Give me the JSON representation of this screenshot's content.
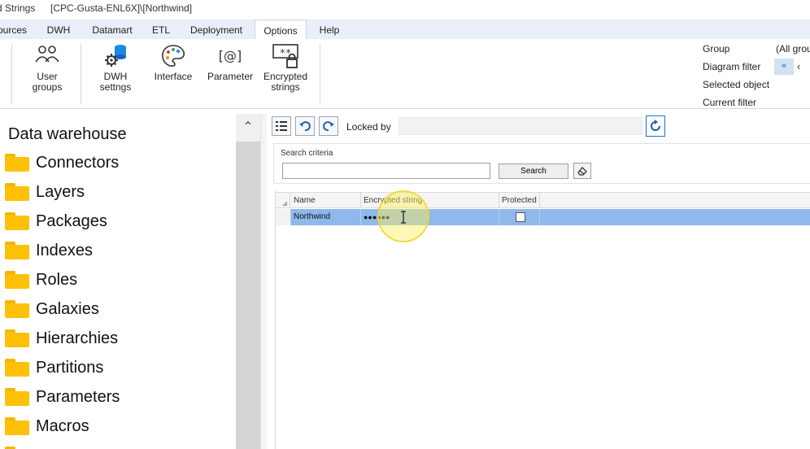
{
  "titlebar": {
    "part1": "d Strings",
    "part2": "[CPC-Gusta-ENL6X]\\[Northwind]"
  },
  "menu": {
    "tabs": [
      {
        "label": "ources"
      },
      {
        "label": "DWH"
      },
      {
        "label": "Datamart"
      },
      {
        "label": "ETL"
      },
      {
        "label": "Deployment"
      },
      {
        "label": "Options"
      },
      {
        "label": "Help"
      }
    ],
    "active": "Options"
  },
  "ribbon": {
    "buttons": [
      {
        "label": "User\ngroups",
        "icon": "users-icon"
      },
      {
        "label": "DWH\nsettngs",
        "icon": "database-gear-icon"
      },
      {
        "label": "Interface",
        "icon": "palette-icon"
      },
      {
        "label": "Parameter",
        "icon": "parameter-at-icon"
      },
      {
        "label": "Encrypted\nstrings",
        "icon": "encrypted-lock-icon"
      }
    ],
    "filters": {
      "group_label": "Group",
      "group_value": "(All grou",
      "diagram_filter_label": "Diagram filter",
      "selected_object_label": "Selected object",
      "current_filter_label": "Current filter"
    }
  },
  "tree": {
    "root": "Data warehouse",
    "items": [
      {
        "label": "Connectors"
      },
      {
        "label": "Layers"
      },
      {
        "label": "Packages"
      },
      {
        "label": "Indexes"
      },
      {
        "label": "Roles"
      },
      {
        "label": "Galaxies"
      },
      {
        "label": "Hierarchies"
      },
      {
        "label": "Partitions"
      },
      {
        "label": "Parameters"
      },
      {
        "label": "Macros"
      }
    ]
  },
  "editor": {
    "locked_by_label": "Locked by",
    "locked_by_value": "",
    "search_legend": "Search criteria",
    "search_value": "",
    "search_button": "Search",
    "grid": {
      "columns": [
        "Name",
        "Encrypted string",
        "Protected"
      ],
      "rows": [
        {
          "name": "Northwind",
          "encrypted": "●●●●●●",
          "protected": false
        }
      ]
    }
  },
  "colors": {
    "accent": "#1e6fc2",
    "selected_row": "#8fb8ec",
    "folder": "#ffc107",
    "menubar": "#e8eff8"
  }
}
